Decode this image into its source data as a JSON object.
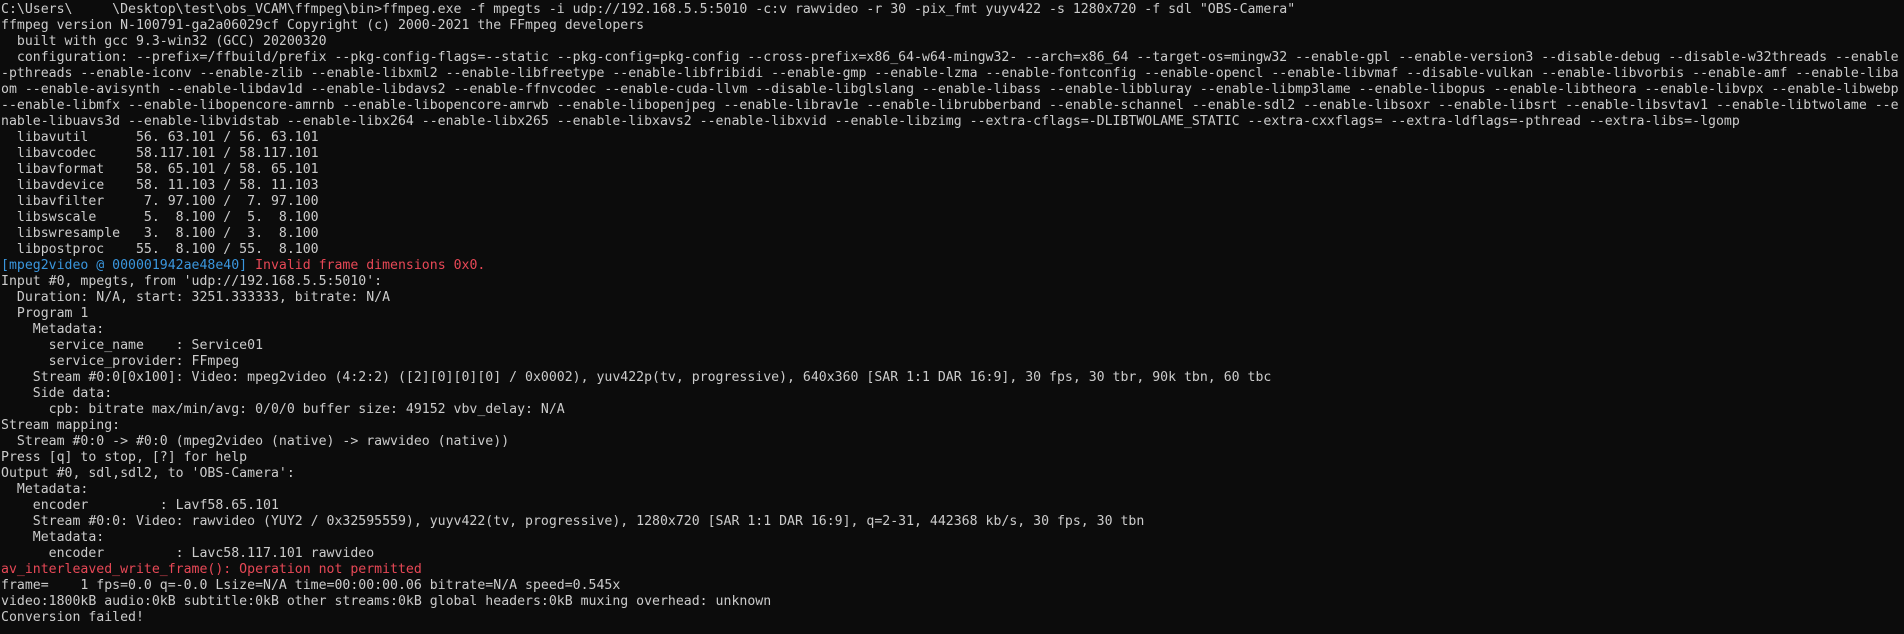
{
  "colors": {
    "background": "#0c0c0c",
    "text": "#cccccc",
    "tag": "#3a96dd",
    "error": "#e74856"
  },
  "terminal": {
    "prompt_line": "C:\\Users\\     \\Desktop\\test\\obs_VCAM\\ffmpeg\\bin>ffmpeg.exe -f mpegts -i udp://192.168.5.5:5010 -c:v rawvideo -r 30 -pix_fmt yuyv422 -s 1280x720 -f sdl \"OBS-Camera\"",
    "version_line": "ffmpeg version N-100791-ga2a06029cf Copyright (c) 2000-2021 the FFmpeg developers",
    "built_line": "  built with gcc 9.3-win32 (GCC) 20200320",
    "configuration": "  configuration: --prefix=/ffbuild/prefix --pkg-config-flags=--static --pkg-config=pkg-config --cross-prefix=x86_64-w64-mingw32- --arch=x86_64 --target-os=mingw32 --enable-gpl --enable-version3 --disable-debug --disable-w32threads --enable-pthreads --enable-iconv --enable-zlib --enable-libxml2 --enable-libfreetype --enable-libfribidi --enable-gmp --enable-lzma --enable-fontconfig --enable-opencl --enable-libvmaf --disable-vulkan --enable-libvorbis --enable-amf --enable-libaom --enable-avisynth --enable-libdav1d --enable-libdavs2 --enable-ffnvcodec --enable-cuda-llvm --disable-libglslang --enable-libass --enable-libbluray --enable-libmp3lame --enable-libopus --enable-libtheora --enable-libvpx --enable-libwebp --enable-libmfx --enable-libopencore-amrnb --enable-libopencore-amrwb --enable-libopenjpeg --enable-librav1e --enable-librubberband --enable-schannel --enable-sdl2 --enable-libsoxr --enable-libsrt --enable-libsvtav1 --enable-libtwolame --enable-libuavs3d --enable-libvidstab --enable-libx264 --enable-libx265 --enable-libxavs2 --enable-libxvid --enable-libzimg --extra-cflags=-DLIBTWOLAME_STATIC --extra-cxxflags= --extra-ldflags=-pthread --extra-libs=-lgomp",
    "libs": [
      "  libavutil      56. 63.101 / 56. 63.101",
      "  libavcodec     58.117.101 / 58.117.101",
      "  libavformat    58. 65.101 / 58. 65.101",
      "  libavdevice    58. 11.103 / 58. 11.103",
      "  libavfilter     7. 97.100 /  7. 97.100",
      "  libswscale      5.  8.100 /  5.  8.100",
      "  libswresample   3.  8.100 /  3.  8.100",
      "  libpostproc    55.  8.100 / 55.  8.100"
    ],
    "warning_tag": "[mpeg2video @ 000001942ae48e40]",
    "warning_msg": " Invalid frame dimensions 0x0.",
    "input_lines": [
      "Input #0, mpegts, from 'udp://192.168.5.5:5010':",
      "  Duration: N/A, start: 3251.333333, bitrate: N/A",
      "  Program 1",
      "    Metadata:",
      "      service_name    : Service01",
      "      service_provider: FFmpeg",
      "    Stream #0:0[0x100]: Video: mpeg2video (4:2:2) ([2][0][0][0] / 0x0002), yuv422p(tv, progressive), 640x360 [SAR 1:1 DAR 16:9], 30 fps, 30 tbr, 90k tbn, 60 tbc",
      "    Side data:",
      "      cpb: bitrate max/min/avg: 0/0/0 buffer size: 49152 vbv_delay: N/A",
      "Stream mapping:",
      "  Stream #0:0 -> #0:0 (mpeg2video (native) -> rawvideo (native))",
      "Press [q] to stop, [?] for help",
      "Output #0, sdl,sdl2, to 'OBS-Camera':",
      "  Metadata:",
      "    encoder         : Lavf58.65.101",
      "    Stream #0:0: Video: rawvideo (YUY2 / 0x32595559), yuyv422(tv, progressive), 1280x720 [SAR 1:1 DAR 16:9], q=2-31, 442368 kb/s, 30 fps, 30 tbn",
      "    Metadata:",
      "      encoder         : Lavc58.117.101 rawvideo"
    ],
    "write_error": "av_interleaved_write_frame(): Operation not permitted",
    "tail_lines": [
      "frame=    1 fps=0.0 q=-0.0 Lsize=N/A time=00:00:00.06 bitrate=N/A speed=0.545x",
      "video:1800kB audio:0kB subtitle:0kB other streams:0kB global headers:0kB muxing overhead: unknown",
      "Conversion failed!"
    ]
  }
}
